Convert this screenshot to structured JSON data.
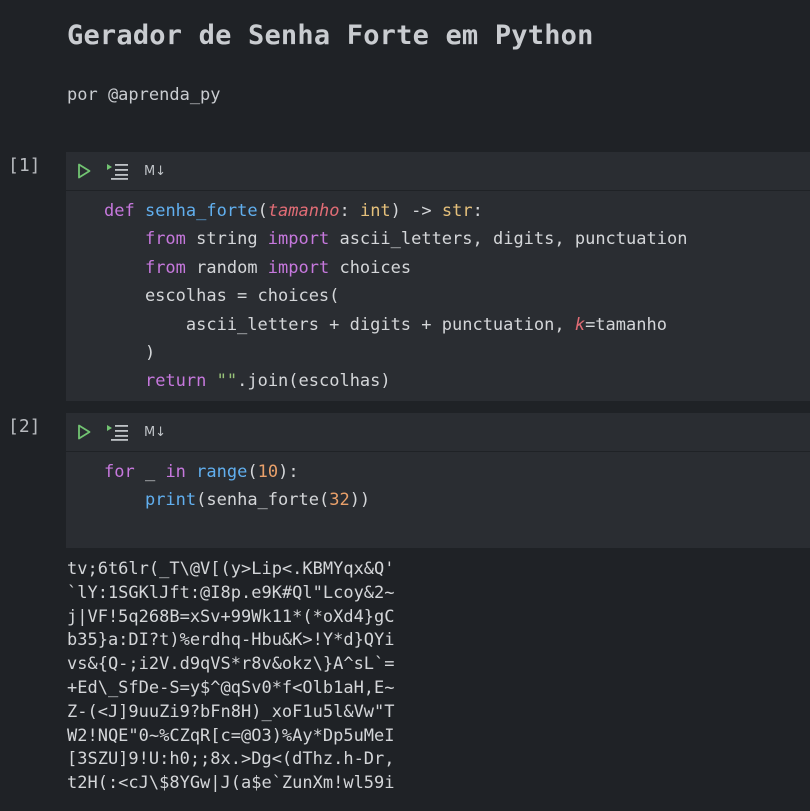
{
  "notebook": {
    "title": "Gerador de Senha Forte em Python",
    "subtitle": "por @aprenda_py",
    "toolbar": {
      "run_icon": "play-icon",
      "run_above_icon": "run-above-icon",
      "markdown_label": "M↓"
    },
    "cells": [
      {
        "exec_count": "[1]",
        "code_lines": [
          "def senha_forte(tamanho: int) -> str:",
          "    from string import ascii_letters, digits, punctuation",
          "    from random import choices",
          "    escolhas = choices(",
          "        ascii_letters + digits + punctuation, k=tamanho",
          "    )",
          "    return \"\".join(escolhas)"
        ]
      },
      {
        "exec_count": "[2]",
        "code_lines": [
          "for _ in range(10):",
          "    print(senha_forte(32))"
        ],
        "output_lines": [
          "tv;6t6lr(_T\\@V[(y>Lip<.KBMYqx&Q'",
          "`lY:1SGKlJft:@I8p.e9K#Ql\"Lcoy&2~",
          "j|VF!5q268B=xSv+99Wk11*(*oXd4}gC",
          "b35}a:DI?t)%erdhq-Hbu&K>!Y*d}QYi",
          "vs&{Q-;i2V.d9qVS*r8v&okz\\}A^sL`=",
          "+Ed\\_SfDe-S=y$^@qSv0*f<Olb1aH,E~",
          "Z-(<J]9uuZi9?bFn8H)_xoF1u5l&Vw\"T",
          "W2!NQE\"0~%CZqR[c=@O3)%Ay*Dp5uMeI",
          "[3SZU]9!U:h0;;8x.>Dg<(dThz.h-Dr,",
          "t2H(:<cJ\\$8YGw|J(a$e`ZunXm!wl59i"
        ]
      }
    ]
  }
}
